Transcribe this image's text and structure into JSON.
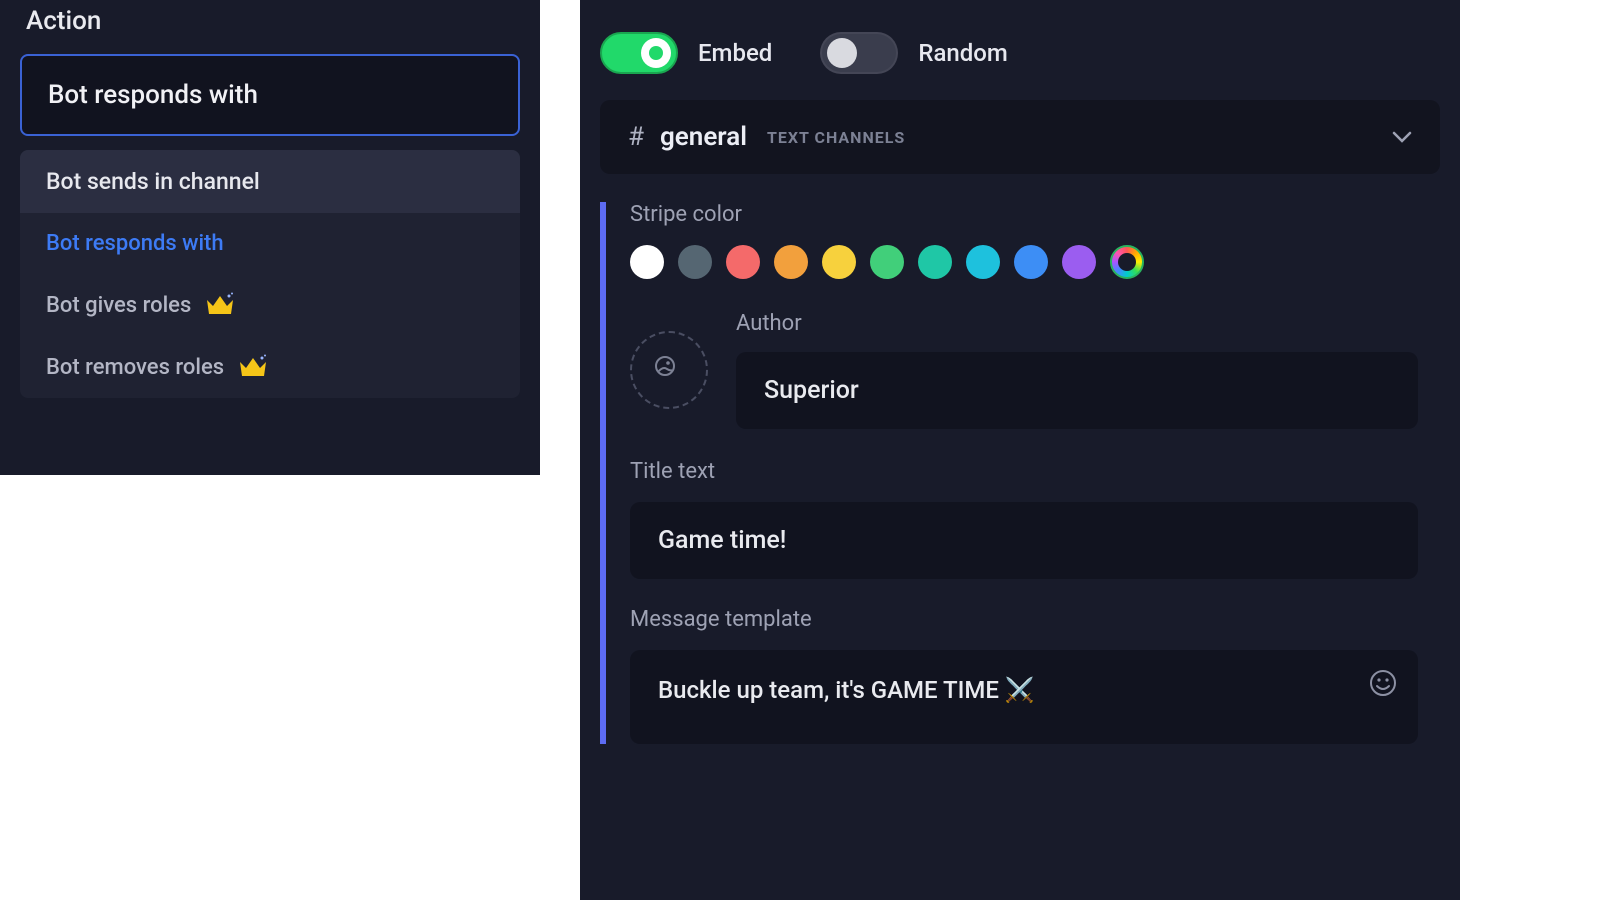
{
  "action": {
    "label": "Action",
    "selected": "Bot responds with",
    "options": [
      {
        "label": "Bot sends in channel",
        "premium": false
      },
      {
        "label": "Bot responds with",
        "premium": false
      },
      {
        "label": "Bot gives roles",
        "premium": true
      },
      {
        "label": "Bot removes roles",
        "premium": true
      }
    ]
  },
  "toggles": {
    "embed": {
      "label": "Embed",
      "on": true
    },
    "random": {
      "label": "Random",
      "on": false
    }
  },
  "channel": {
    "name": "general",
    "group": "TEXT CHANNELS"
  },
  "stripe": {
    "label": "Stripe color",
    "colors": [
      "#ffffff",
      "#556672",
      "#f46a6a",
      "#f2a03d",
      "#f7d13d",
      "#41cf7a",
      "#1fc7a6",
      "#1ec1dd",
      "#3d8ef5",
      "#9b5df0"
    ],
    "accent": "#5d6cf2"
  },
  "author": {
    "label": "Author",
    "value": "Superior"
  },
  "title": {
    "label": "Title text",
    "value": "Game time!"
  },
  "message": {
    "label": "Message template",
    "value": "Buckle up team, it's GAME TIME ⚔️"
  }
}
